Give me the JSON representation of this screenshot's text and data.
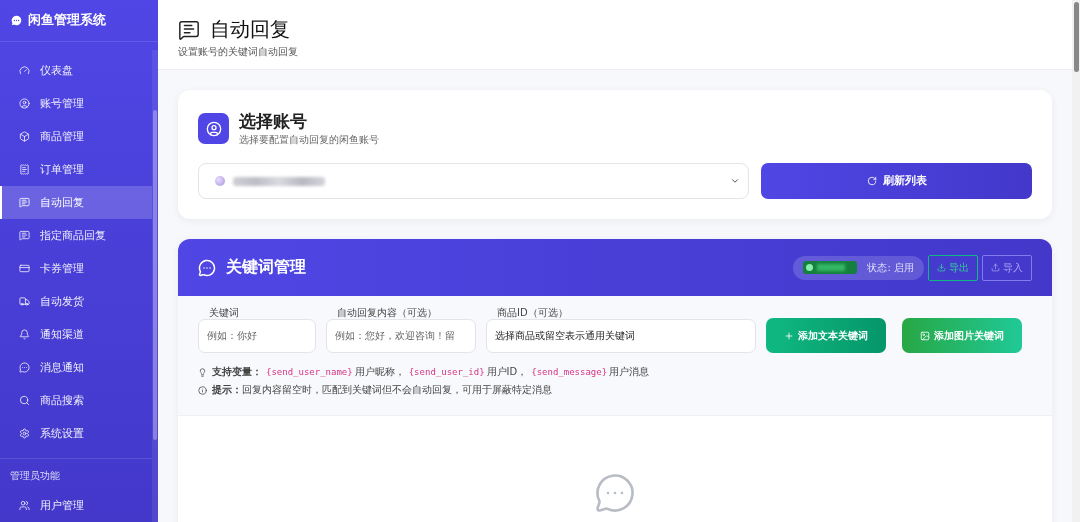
{
  "sidebar": {
    "title": "闲鱼管理系统",
    "items": [
      {
        "label": "仪表盘",
        "selected": false
      },
      {
        "label": "账号管理",
        "selected": false
      },
      {
        "label": "商品管理",
        "selected": false
      },
      {
        "label": "订单管理",
        "selected": false
      },
      {
        "label": "自动回复",
        "selected": true
      },
      {
        "label": "指定商品回复",
        "selected": false
      },
      {
        "label": "卡券管理",
        "selected": false
      },
      {
        "label": "自动发货",
        "selected": false
      },
      {
        "label": "通知渠道",
        "selected": false
      },
      {
        "label": "消息通知",
        "selected": false
      },
      {
        "label": "商品搜索",
        "selected": false
      },
      {
        "label": "系统设置",
        "selected": false
      }
    ],
    "section_label": "管理员功能",
    "admin_items": [
      {
        "label": "用户管理",
        "selected": false
      }
    ]
  },
  "header": {
    "title": "自动回复",
    "subtitle": "设置账号的关键词自动回复"
  },
  "account_card": {
    "title": "选择账号",
    "subtitle": "选择要配置自动回复的闲鱼账号",
    "refresh_button": "刷新列表"
  },
  "keyword_card": {
    "title": "关键词管理",
    "status_switch": {
      "on": true,
      "label": "状态: 启用"
    },
    "export_button": {
      "label": "导出",
      "disabled": false
    },
    "import_button": {
      "label": "导入",
      "disabled": true
    },
    "fields": [
      {
        "label": "关键词",
        "placeholder": "例如：你好"
      },
      {
        "label": "自动回复内容（可选）",
        "placeholder": "例如：您好，欢迎咨询！留"
      },
      {
        "label": "商品ID（可选）",
        "value": "选择商品或留空表示通用关键词"
      }
    ],
    "add_text_button": "添加文本关键词",
    "add_image_button": "添加图片关键词",
    "hints": [
      {
        "label": "支持变量：",
        "parts": [
          {
            "kind": "code",
            "text": "{send_user_name}"
          },
          {
            "kind": "text",
            "text": "用户昵称，"
          },
          {
            "kind": "code",
            "text": "{send_user_id}"
          },
          {
            "kind": "text",
            "text": "用户ID，"
          },
          {
            "kind": "code",
            "text": "{send_message}"
          },
          {
            "kind": "text",
            "text": "用户消息"
          }
        ]
      },
      {
        "label": "提示：",
        "parts": [
          {
            "kind": "text",
            "text": "回复内容留空时，匹配到关键词但不会自动回复，可用于屏蔽特定消息"
          }
        ]
      }
    ]
  }
}
